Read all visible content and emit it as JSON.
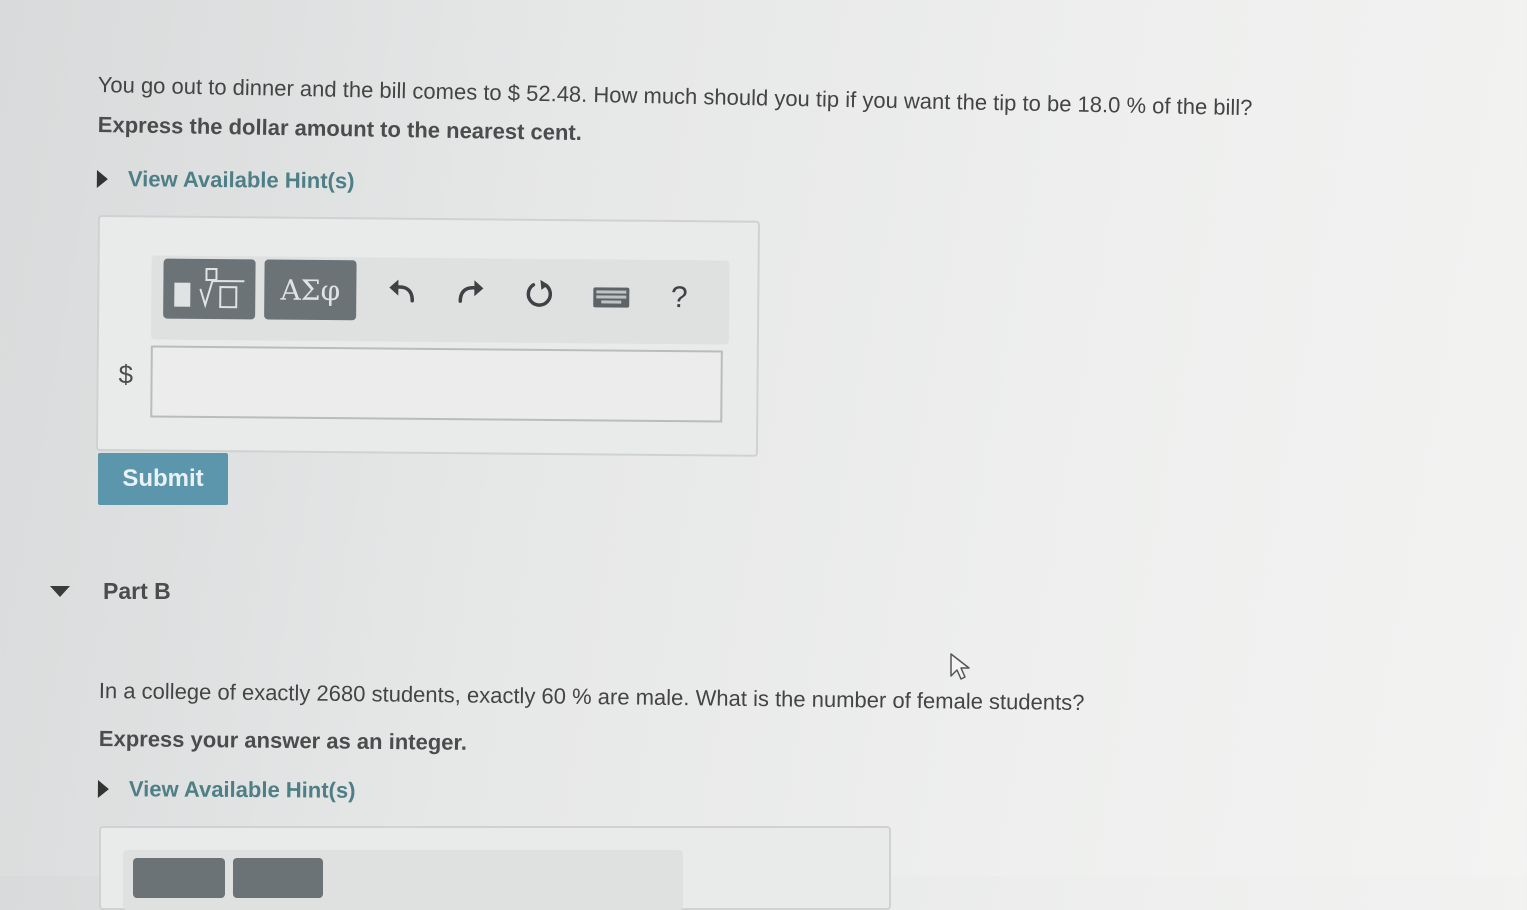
{
  "partA": {
    "question": "You go out to dinner and the bill comes to $ 52.48. How much should you tip if you want the tip to be 18.0 % of the bill?",
    "instruction": "Express the dollar amount to the nearest cent.",
    "hint_label": "View Available Hint(s)",
    "toolbar": {
      "templates_label": "√",
      "greek_label": "ΑΣφ",
      "help_label": "?"
    },
    "currency_symbol": "$",
    "answer_value": "",
    "submit_label": "Submit"
  },
  "partB": {
    "title": "Part B",
    "question": "In a college of exactly 2680 students, exactly 60 % are male.  What is the number of female students?",
    "instruction": "Express your answer as an integer.",
    "hint_label": "View Available Hint(s)"
  },
  "colors": {
    "hint_link": "#4e7f86",
    "submit_bg": "#5b96ad",
    "toolbar_dark": "#6b7377"
  }
}
